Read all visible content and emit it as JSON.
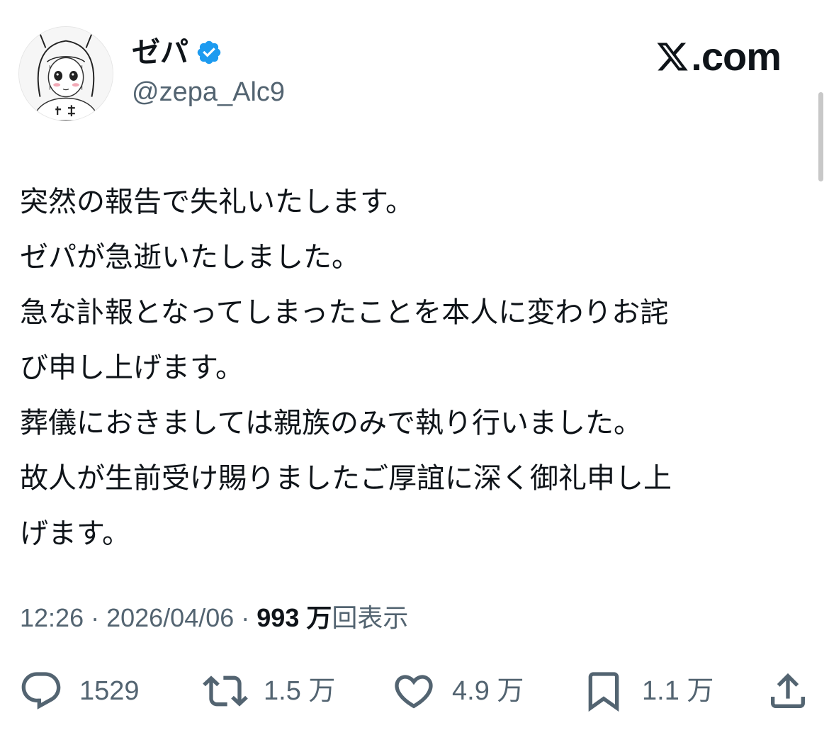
{
  "author": {
    "display_name": "ゼパ",
    "handle": "@zepa_Alc9",
    "verified": true,
    "avatar_icon": "avatar-illustration"
  },
  "brand": {
    "icon": "x-logo-icon",
    "text": ".com"
  },
  "tweet": {
    "lines": [
      "突然の報告で失礼いたします。",
      "ゼパが急逝いたしました。",
      "急な訃報となってしまったことを本人に変わりお詫",
      "び申し上げます。",
      "葬儀におきましては親族のみで執り行いました。",
      "故人が生前受け賜りましたご厚誼に深く御礼申し上",
      "げます。"
    ]
  },
  "meta": {
    "time": "12:26",
    "separator": " · ",
    "date": "2026/04/06",
    "views_count": "993 万",
    "views_label": "回表示"
  },
  "actions": {
    "reply": {
      "icon": "reply-icon",
      "count": "1529"
    },
    "retweet": {
      "icon": "retweet-icon",
      "count": "1.5 万"
    },
    "like": {
      "icon": "heart-icon",
      "count": "4.9 万"
    },
    "bookmark": {
      "icon": "bookmark-icon",
      "count": "1.1 万"
    },
    "share": {
      "icon": "share-icon"
    }
  },
  "colors": {
    "text": "#0f1419",
    "secondary": "#536471",
    "verified": "#1d9bf0"
  }
}
